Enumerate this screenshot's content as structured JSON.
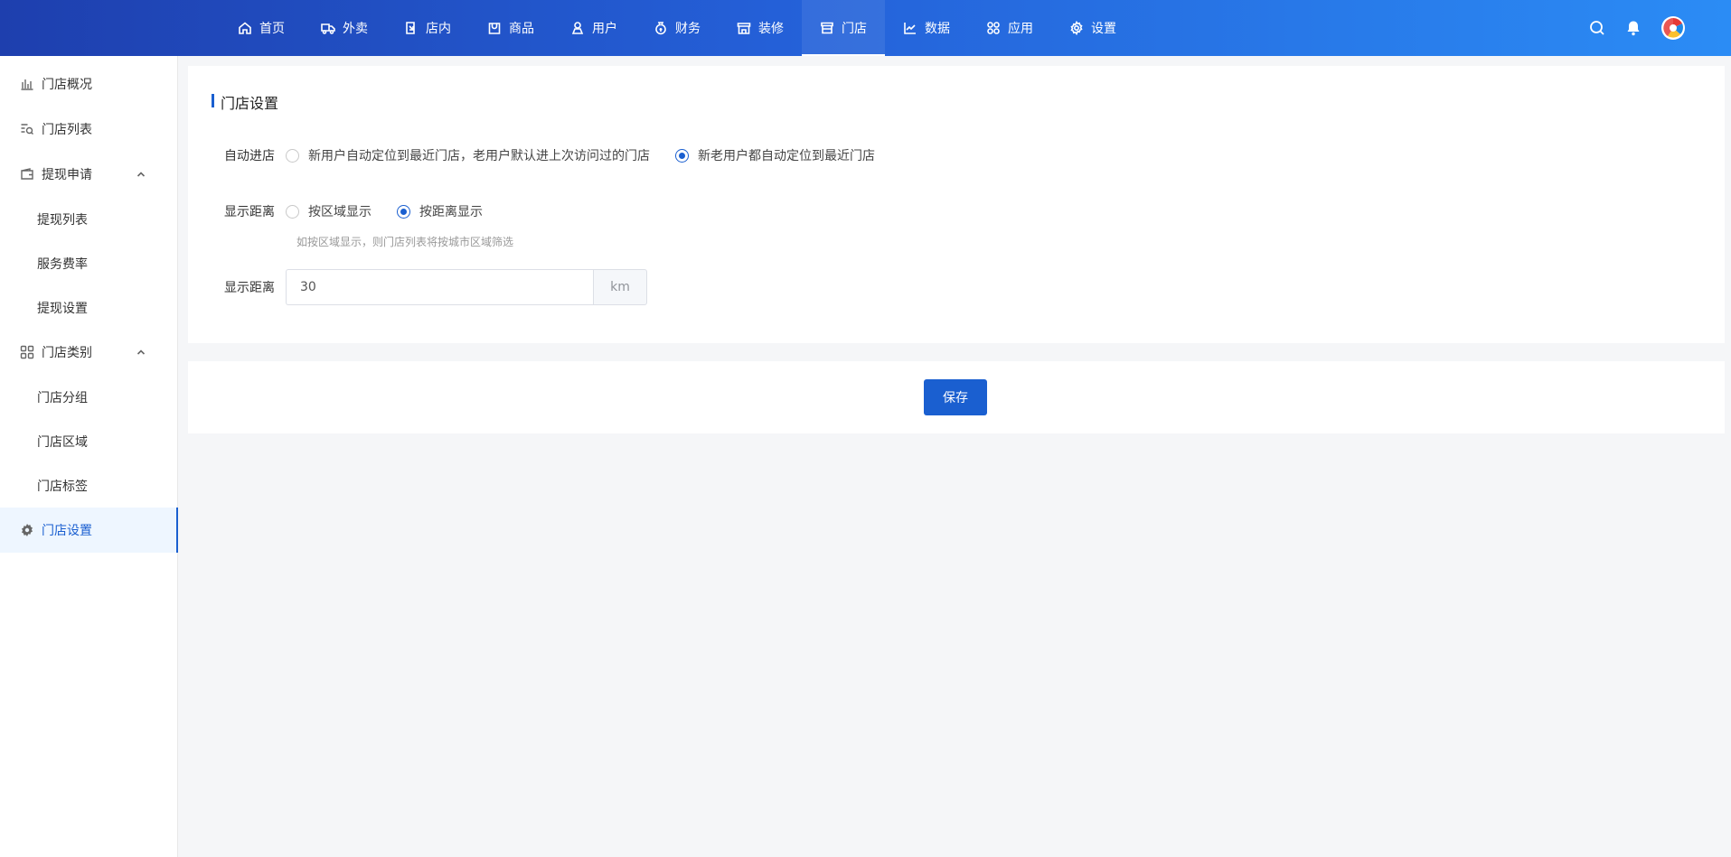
{
  "topnav": {
    "items": [
      {
        "label": "首页",
        "icon": "home-icon"
      },
      {
        "label": "外卖",
        "icon": "delivery-icon"
      },
      {
        "label": "店内",
        "icon": "dine-in-icon"
      },
      {
        "label": "商品",
        "icon": "goods-icon"
      },
      {
        "label": "用户",
        "icon": "user-icon"
      },
      {
        "label": "财务",
        "icon": "finance-icon"
      },
      {
        "label": "装修",
        "icon": "decorate-icon"
      },
      {
        "label": "门店",
        "icon": "store-icon",
        "active": true
      },
      {
        "label": "数据",
        "icon": "data-chart-icon"
      },
      {
        "label": "应用",
        "icon": "apps-icon"
      },
      {
        "label": "设置",
        "icon": "gear-icon"
      }
    ]
  },
  "sidebar": {
    "overview": "门店概况",
    "list": "门店列表",
    "withdraw": {
      "label": "提现申请",
      "children": [
        "提现列表",
        "服务费率",
        "提现设置"
      ]
    },
    "category": {
      "label": "门店类别",
      "children": [
        "门店分组",
        "门店区域",
        "门店标签"
      ]
    },
    "settings": "门店设置"
  },
  "main": {
    "title": "门店设置",
    "auto_enter": {
      "label": "自动进店",
      "options": [
        "新用户自动定位到最近门店，老用户默认进上次访问过的门店",
        "新老用户都自动定位到最近门店"
      ],
      "selected": 1
    },
    "display_mode": {
      "label": "显示距离",
      "options": [
        "按区域显示",
        "按距离显示"
      ],
      "selected": 1,
      "hint": "如按区域显示，则门店列表将按城市区域筛选"
    },
    "distance": {
      "label": "显示距离",
      "value": "30",
      "unit": "km"
    },
    "save_label": "保存"
  },
  "colors": {
    "primary": "#1a5fd0",
    "topbar_start": "#1e3fae",
    "topbar_end": "#2b8cf5"
  }
}
